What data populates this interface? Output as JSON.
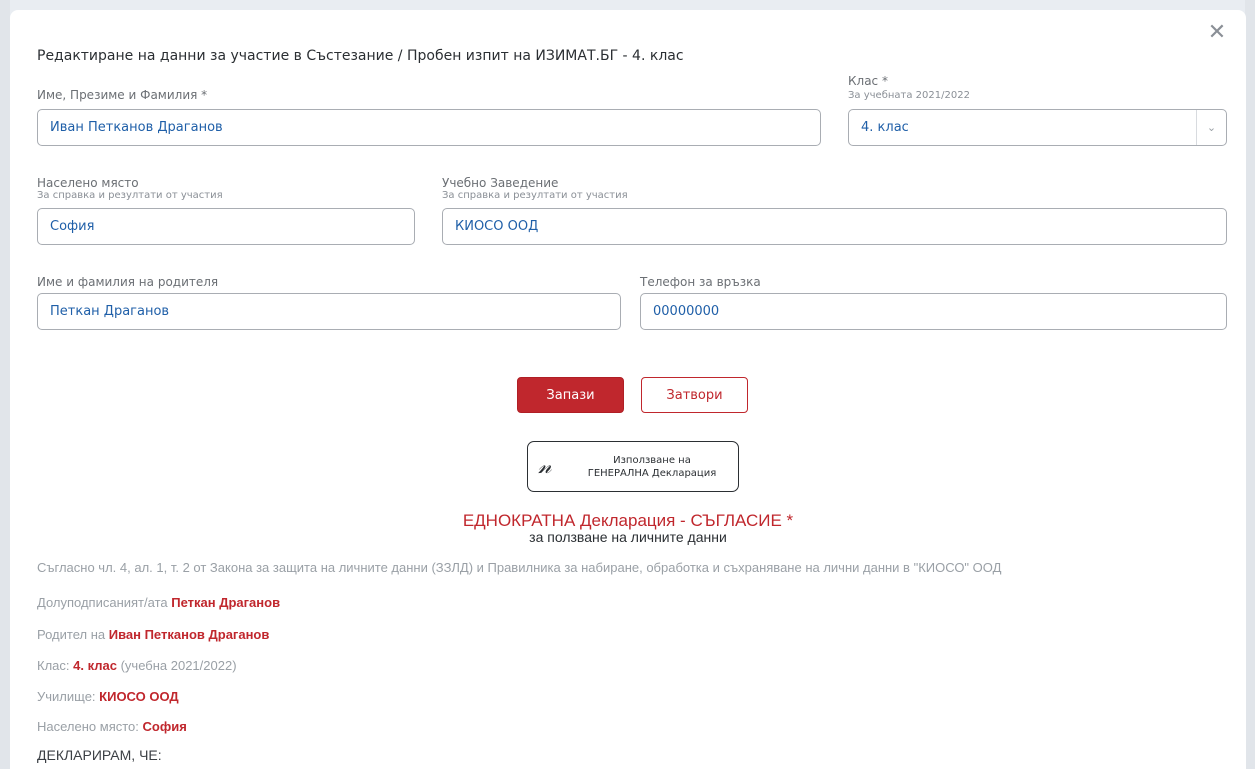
{
  "dialog": {
    "title": "Редактиране на данни за участие в Състезание / Пробен изпит на ИЗИМАТ.БГ - 4. клас",
    "close_glyph": "✕"
  },
  "form": {
    "name_label": "Име, Презиме и Фамилия *",
    "name_value": "Иван Петканов Драганов",
    "class_label": "Клас *",
    "class_sublabel": "За учебната 2021/2022",
    "class_value": "4. клас",
    "city_label": "Населено място",
    "city_sublabel": "За справка и резултати от участия",
    "city_value": "София",
    "school_label": "Учебно Заведение",
    "school_sublabel": "За справка и резултати от участия",
    "school_value": "КИОСО ООД",
    "parent_label": "Име и фамилия на родителя",
    "parent_value": "Петкан Драганов",
    "phone_label": "Телефон за връзка",
    "phone_value": "00000000"
  },
  "buttons": {
    "save": "Запази",
    "close": "Затвори",
    "general_line1": "Използване на",
    "general_line2": "ГЕНЕРАЛНА Декларация"
  },
  "declaration": {
    "title": "ЕДНОКРАТНА Декларация - СЪГЛАСИЕ *",
    "subtitle": "за ползване на личните данни",
    "intro": "Съгласно чл. 4, ал. 1, т. 2 от Закона за защита на личните данни (ЗЗЛД) и Правилника за набиране, обработка и съхраняване на лични данни в \"КИОСО\" ООД",
    "signer_prefix": "Долуподписаният/ата",
    "signer_value": "Петкан Драганов",
    "parent_prefix": "Родител на",
    "parent_value": "Иван Петканов Драганов",
    "class_prefix": "Клас:",
    "class_value": "4. клас",
    "class_suffix": "(учебна 2021/2022)",
    "school_prefix": "Училище:",
    "school_value": "КИОСО ООД",
    "city_prefix": "Населено място:",
    "city_value": "София",
    "declare": "ДЕКЛАРИРАМ, ЧЕ:"
  }
}
